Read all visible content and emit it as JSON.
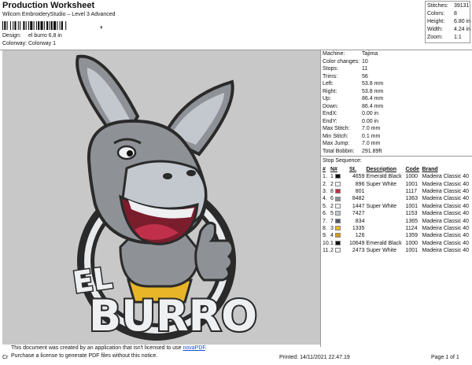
{
  "header": {
    "title": "Production Worksheet",
    "software": "Wilcom EmbroideryStudio – Level 3 Advanced",
    "barcode_mark": ",",
    "design_label": "Design:",
    "design_value": "el burro 6,8 in",
    "colorway_label": "Colorway:",
    "colorway_value": "Colorway 1"
  },
  "stats": [
    {
      "label": "Stitches:",
      "value": "39131"
    },
    {
      "label": "Colors:",
      "value": "8"
    },
    {
      "label": "Height:",
      "value": "6.80 in"
    },
    {
      "label": "Width:",
      "value": "4.24 in"
    },
    {
      "label": "Zoom:",
      "value": "1:1"
    }
  ],
  "machine_info": [
    {
      "label": "Machine:",
      "value": "Tajima"
    },
    {
      "label": "Color changes:",
      "value": "10"
    },
    {
      "label": "Stops:",
      "value": "11"
    },
    {
      "label": "Trims:",
      "value": "56"
    },
    {
      "label": "Left:",
      "value": "53.8 mm"
    },
    {
      "label": "Right:",
      "value": "53.8 mm"
    },
    {
      "label": "Up:",
      "value": "86.4 mm"
    },
    {
      "label": "Down:",
      "value": "86.4 mm"
    },
    {
      "label": "EndX:",
      "value": "0.00 in"
    },
    {
      "label": "EndY:",
      "value": "0.00 in"
    },
    {
      "label": "Max Stitch:",
      "value": "7.0 mm"
    },
    {
      "label": "Min Stitch:",
      "value": "0.1 mm"
    },
    {
      "label": "Max Jump:",
      "value": "7.0 mm"
    },
    {
      "label": "Total Bobbin:",
      "value": "291.89ft"
    }
  ],
  "stop_sequence": {
    "title": "Stop Sequence:",
    "columns": [
      "#",
      "N#",
      "St.",
      "Description",
      "Code",
      "Brand"
    ],
    "rows": [
      {
        "num": "1.",
        "n": "1",
        "color": "#111111",
        "st": "4659",
        "desc": "Emerald Black",
        "code": "1000",
        "brand": "Madeira Classic 40"
      },
      {
        "num": "2.",
        "n": "2",
        "color": "#eef0f2",
        "st": "896",
        "desc": "Super White",
        "code": "1001",
        "brand": "Madeira Classic 40"
      },
      {
        "num": "3.",
        "n": "8",
        "color": "#c0304a",
        "st": "801",
        "desc": "",
        "code": "1117",
        "brand": "Madeira Classic 40"
      },
      {
        "num": "4.",
        "n": "6",
        "color": "#8e9196",
        "st": "8482",
        "desc": "",
        "code": "1363",
        "brand": "Madeira Classic 40"
      },
      {
        "num": "5.",
        "n": "2",
        "color": "#eef0f2",
        "st": "1447",
        "desc": "Super White",
        "code": "1001",
        "brand": "Madeira Classic 40"
      },
      {
        "num": "6.",
        "n": "5",
        "color": "#c3c8cf",
        "st": "7427",
        "desc": "",
        "code": "1153",
        "brand": "Madeira Classic 40"
      },
      {
        "num": "7.",
        "n": "7",
        "color": "#525a66",
        "st": "834",
        "desc": "",
        "code": "1365",
        "brand": "Madeira Classic 40"
      },
      {
        "num": "8.",
        "n": "3",
        "color": "#e8b528",
        "st": "1335",
        "desc": "",
        "code": "1124",
        "brand": "Madeira Classic 40"
      },
      {
        "num": "9.",
        "n": "4",
        "color": "#d59a1e",
        "st": "126",
        "desc": "",
        "code": "1359",
        "brand": "Madeira Classic 40"
      },
      {
        "num": "10.",
        "n": "1",
        "color": "#111111",
        "st": "10649",
        "desc": "Emerald Black",
        "code": "1000",
        "brand": "Madeira Classic 40"
      },
      {
        "num": "11.",
        "n": "2",
        "color": "#eef0f2",
        "st": "2473",
        "desc": "Super White",
        "code": "1001",
        "brand": "Madeira Classic 40"
      }
    ]
  },
  "logo_text": {
    "line1": "EL",
    "line2": "BURRO"
  },
  "footer": {
    "notice_before_link": "This document was created by an application that isn't licensed to use ",
    "notice_link": "novaPDF",
    "notice_after_link": ".",
    "notice_line2": "Purchase a license to generate PDF files without this notice.",
    "cr": "Cr",
    "printed": "Printed: 14/11/2021 22.47.19",
    "page": "Page 1 of 1"
  }
}
